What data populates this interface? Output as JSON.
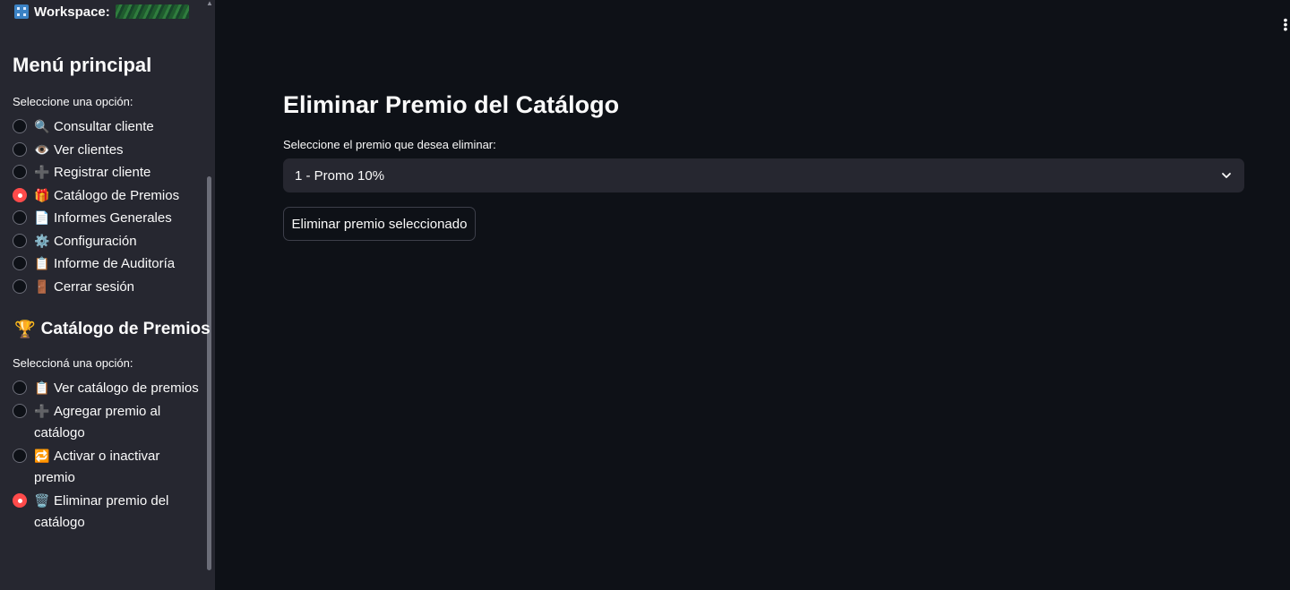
{
  "sidebar": {
    "workspace_label": "Workspace:",
    "main_menu": {
      "title": "Menú principal",
      "caption": "Seleccione una opción:",
      "items": [
        {
          "icon": "🔍",
          "icon_name": "magnifier-icon",
          "label": "Consultar cliente",
          "checked": false
        },
        {
          "icon": "👁️",
          "icon_name": "eye-icon",
          "label": "Ver clientes",
          "checked": false
        },
        {
          "icon": "➕",
          "icon_name": "plus-icon",
          "label": "Registrar cliente",
          "checked": false
        },
        {
          "icon": "🎁",
          "icon_name": "gift-icon",
          "label": "Catálogo de Premios",
          "checked": true
        },
        {
          "icon": "📄",
          "icon_name": "document-icon",
          "label": "Informes Generales",
          "checked": false
        },
        {
          "icon": "⚙️",
          "icon_name": "gear-icon",
          "label": "Configuración",
          "checked": false
        },
        {
          "icon": "📋",
          "icon_name": "clipboard-icon",
          "label": "Informe de Auditoría",
          "checked": false
        },
        {
          "icon": "🚪",
          "icon_name": "door-icon",
          "label": "Cerrar sesión",
          "checked": false
        }
      ]
    },
    "catalog_menu": {
      "icon": "🏆",
      "title": "Catálogo de Premios",
      "caption": "Seleccioná una opción:",
      "items": [
        {
          "icon": "📋",
          "icon_name": "clipboard-icon",
          "label": "Ver catálogo de premios",
          "checked": false
        },
        {
          "icon": "➕",
          "icon_name": "plus-icon",
          "label": "Agregar premio al catálogo",
          "checked": false
        },
        {
          "icon": "🔁",
          "icon_name": "repeat-icon",
          "label": "Activar o inactivar premio",
          "checked": false
        },
        {
          "icon": "🗑️",
          "icon_name": "trash-icon",
          "label": "Eliminar premio del catálogo",
          "checked": true
        }
      ]
    }
  },
  "main": {
    "title": "Eliminar Premio del Catálogo",
    "select_label": "Seleccione el premio que desea eliminar:",
    "select_value": "1 - Promo 10%",
    "delete_button": "Eliminar premio seleccionado"
  },
  "colors": {
    "background": "#0e1117",
    "sidebar": "#262730",
    "accent": "#ff4b4b",
    "text": "#fafafa"
  }
}
